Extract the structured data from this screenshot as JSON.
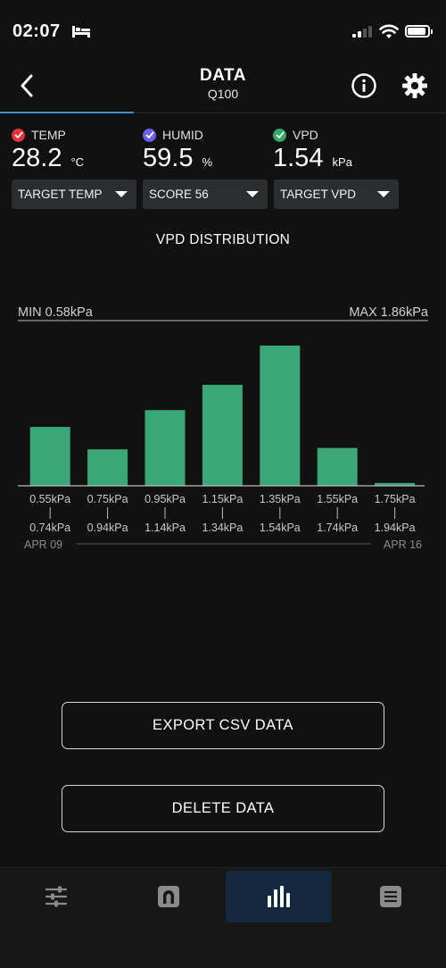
{
  "status_bar": {
    "time": "02:07"
  },
  "header": {
    "title": "DATA",
    "subtitle": "Q100"
  },
  "readings": [
    {
      "label": "TEMP",
      "value": "28.2",
      "unit": "°C",
      "color": "#e5323b"
    },
    {
      "label": "HUMID",
      "value": "59.5",
      "unit": "%",
      "color": "#6b62e6"
    },
    {
      "label": "VPD",
      "value": "1.54",
      "unit": "kPa",
      "color": "#33a66b"
    }
  ],
  "dropdowns": [
    {
      "label": "TARGET TEMP"
    },
    {
      "label": "SCORE 56"
    },
    {
      "label": "TARGET VPD"
    }
  ],
  "chart": {
    "title": "VPD DISTRIBUTION",
    "min_label": "MIN 0.58kPa",
    "max_label": "MAX 1.86kPa",
    "start_date": "APR 09",
    "end_date": "APR 16",
    "bar_color": "#3aa876"
  },
  "chart_data": {
    "type": "bar",
    "title": "VPD DISTRIBUTION",
    "categories": [
      "0.55kPa - 0.74kPa",
      "0.75kPa - 0.94kPa",
      "0.95kPa - 1.14kPa",
      "1.15kPa - 1.34kPa",
      "1.35kPa - 1.54kPa",
      "1.55kPa - 1.74kPa",
      "1.75kPa - 1.94kPa"
    ],
    "range_low": [
      "0.55kPa",
      "0.75kPa",
      "0.95kPa",
      "1.15kPa",
      "1.35kPa",
      "1.55kPa",
      "1.75kPa"
    ],
    "range_high": [
      "0.74kPa",
      "0.94kPa",
      "1.14kPa",
      "1.34kPa",
      "1.54kPa",
      "1.74kPa",
      "1.94kPa"
    ],
    "values": [
      42,
      26,
      54,
      72,
      100,
      27,
      2
    ],
    "ylim": [
      0,
      100
    ],
    "grid": false,
    "xlabel": "",
    "ylabel": ""
  },
  "actions": {
    "export_label": "EXPORT CSV DATA",
    "delete_label": "DELETE DATA"
  },
  "nav": [
    {
      "icon": "sliders-icon",
      "active": false
    },
    {
      "icon": "arch-icon",
      "active": false
    },
    {
      "icon": "bar-chart-icon",
      "active": true
    },
    {
      "icon": "menu-icon",
      "active": false
    }
  ]
}
